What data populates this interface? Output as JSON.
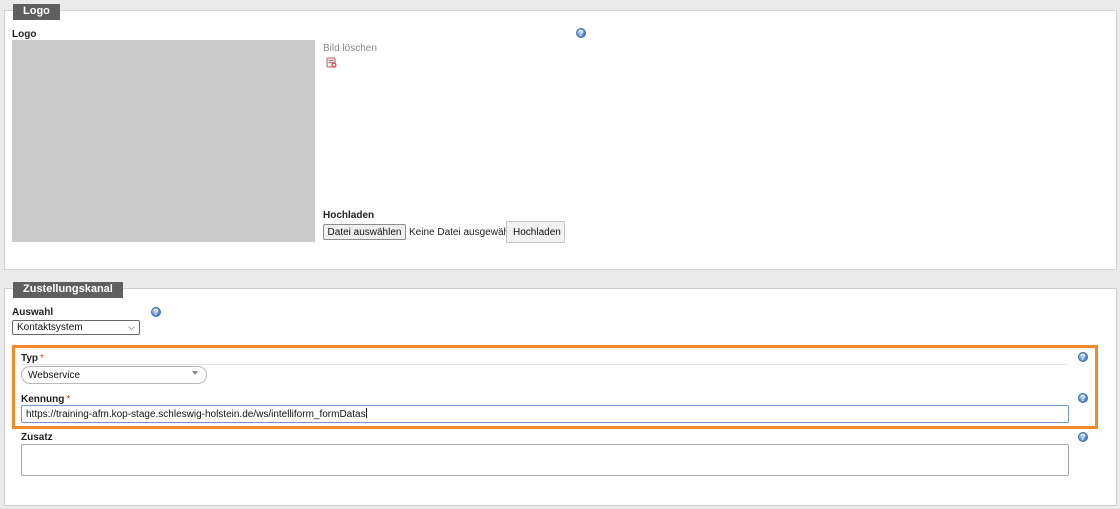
{
  "logo_section": {
    "legend": "Logo",
    "field_label": "Logo",
    "delete_label": "Bild löschen",
    "upload_label": "Hochladen",
    "choose_file_button": "Datei auswählen",
    "no_file_text": "Keine Datei ausgewählt",
    "upload_button": "Hochladen"
  },
  "delivery_section": {
    "legend": "Zustellungskanal",
    "selection_label": "Auswahl",
    "selection_value": "Kontaktsystem",
    "type_label": "Typ",
    "required_marker": "*",
    "type_value": "Webservice",
    "identifier_label": "Kennung",
    "identifier_value": "https://training-afm.kop-stage.schleswig-holstein.de/ws/intelliform_formDatas",
    "extra_label": "Zusatz",
    "extra_value": ""
  },
  "icons": {
    "help": "help-icon",
    "delete": "delete-image-icon",
    "dropdown": "chevron-down-icon"
  },
  "colors": {
    "highlight": "#f38a2a",
    "legend_bg": "#5f5f5f",
    "required": "#e0321b"
  }
}
